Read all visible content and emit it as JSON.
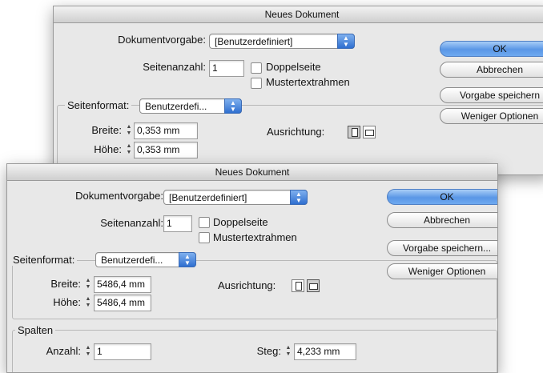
{
  "dialog_back": {
    "title": "Neues Dokument",
    "preset_label": "Dokumentvorgabe:",
    "preset_value": "[Benutzerdefiniert]",
    "pages_label": "Seitenanzahl:",
    "pages_value": "1",
    "facing_label": "Doppelseite",
    "master_label": "Mustertextrahmen",
    "format_label": "Seitenformat:",
    "format_value": "Benutzerdefi...",
    "width_label": "Breite:",
    "width_value": "0,353 mm",
    "height_label": "Höhe:",
    "height_value": "0,353 mm",
    "orientation_label": "Ausrichtung:",
    "ok_label": "OK",
    "cancel_label": "Abbrechen",
    "save_label": "Vorgabe speichern",
    "less_label": "Weniger Optionen"
  },
  "dialog_front": {
    "title": "Neues Dokument",
    "preset_label": "Dokumentvorgabe:",
    "preset_value": "[Benutzerdefiniert]",
    "pages_label": "Seitenanzahl:",
    "pages_value": "1",
    "facing_label": "Doppelseite",
    "master_label": "Mustertextrahmen",
    "format_label": "Seitenformat:",
    "format_value": "Benutzerdefi...",
    "width_label": "Breite:",
    "width_value": "5486,4 mm",
    "height_label": "Höhe:",
    "height_value": "5486,4 mm",
    "orientation_label": "Ausrichtung:",
    "columns_label": "Spalten",
    "count_label": "Anzahl:",
    "count_value": "1",
    "gutter_label": "Steg:",
    "gutter_value": "4,233 mm",
    "ok_label": "OK",
    "cancel_label": "Abbrechen",
    "save_label": "Vorgabe speichern...",
    "less_label": "Weniger Optionen"
  },
  "icons": {
    "stepper": "up-down-stepper-icon",
    "popup_arrow": "popup-arrows-icon",
    "portrait": "portrait-orientation-icon",
    "landscape": "landscape-orientation-icon"
  },
  "colors": {
    "dialog_bg": "#e8e8e8",
    "primary_button": "#5a97e6",
    "popup_arrow": "#2f6fd0"
  }
}
